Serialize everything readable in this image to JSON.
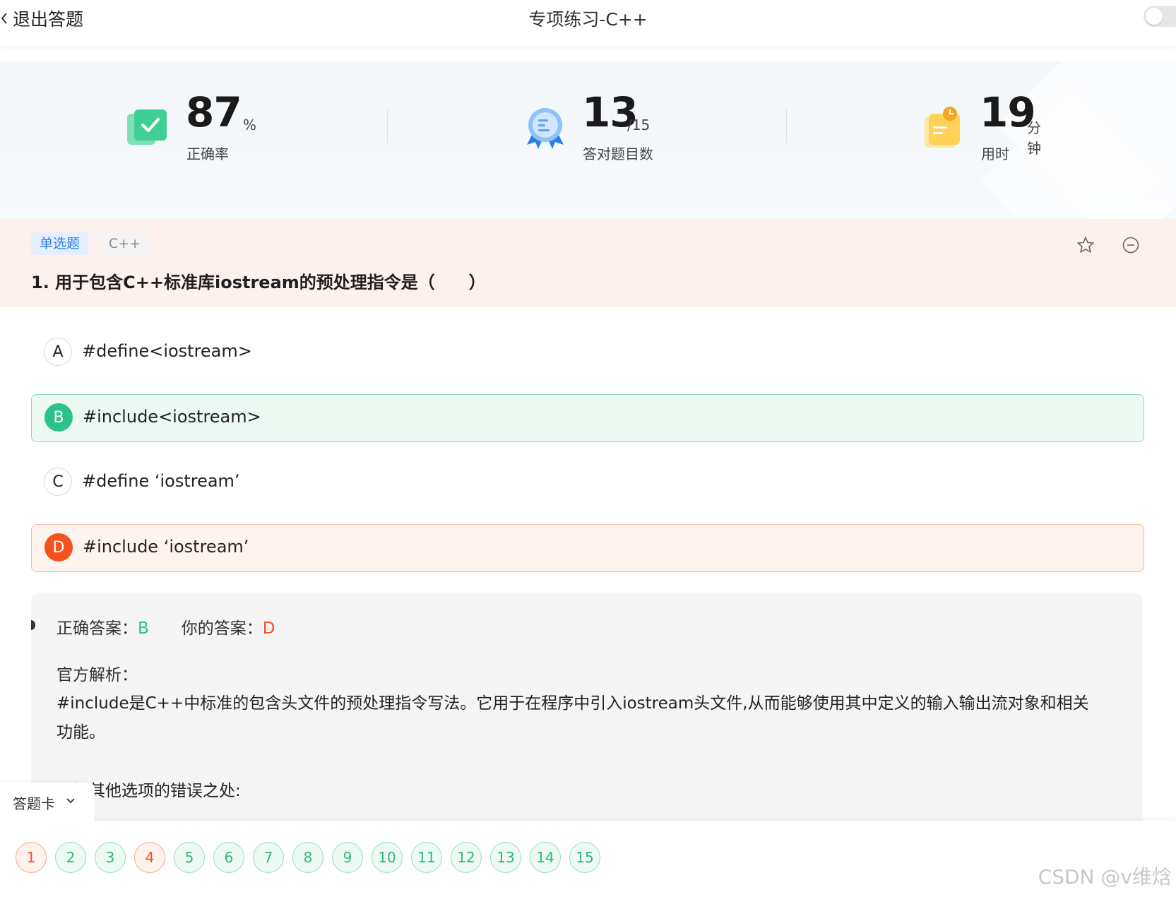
{
  "header": {
    "back_label": "退出答题",
    "title": "专项练习-C++"
  },
  "stats": {
    "accuracy": {
      "value": "87",
      "unit": "%",
      "label": "正确率"
    },
    "correct_count": {
      "value": "13",
      "unit": "/15",
      "label": "答对题目数"
    },
    "time": {
      "value": "19",
      "unit": "分钟",
      "label": "用时"
    }
  },
  "question": {
    "type_tag": "单选题",
    "lang_tag": "C++",
    "text": "1. 用于包含C++标准库iostream的预处理指令是（　　）",
    "options": [
      {
        "letter": "A",
        "text": "#define<iostream>",
        "state": "normal"
      },
      {
        "letter": "B",
        "text": "#include<iostream>",
        "state": "correct"
      },
      {
        "letter": "C",
        "text": "#define ‘iostream’",
        "state": "normal"
      },
      {
        "letter": "D",
        "text": "#include ‘iostream’",
        "state": "wrong"
      }
    ]
  },
  "analysis": {
    "correct_label": "正确答案：",
    "correct_value": "B",
    "mine_label": "你的答案：",
    "mine_value": "D",
    "title": "官方解析：",
    "body": "#include是C++中标准的包含头文件的预处理指令写法。它用于在程序中引入iostream头文件,从而能够使用其中定义的输入输出流对象和相关功能。",
    "more": "分析其他选项的错误之处:"
  },
  "answer_card": {
    "label": "答题卡",
    "items": [
      {
        "n": "1",
        "state": "wrong"
      },
      {
        "n": "2",
        "state": "correct"
      },
      {
        "n": "3",
        "state": "correct"
      },
      {
        "n": "4",
        "state": "wrong"
      },
      {
        "n": "5",
        "state": "correct"
      },
      {
        "n": "6",
        "state": "correct"
      },
      {
        "n": "7",
        "state": "correct"
      },
      {
        "n": "8",
        "state": "correct"
      },
      {
        "n": "9",
        "state": "correct"
      },
      {
        "n": "10",
        "state": "correct"
      },
      {
        "n": "11",
        "state": "correct"
      },
      {
        "n": "12",
        "state": "correct"
      },
      {
        "n": "13",
        "state": "correct"
      },
      {
        "n": "14",
        "state": "correct"
      },
      {
        "n": "15",
        "state": "correct"
      }
    ]
  },
  "watermark": "CSDN @v维焓",
  "colors": {
    "correct": "#2cc28a",
    "wrong": "#f4511e",
    "accent_blue": "#2f7be8"
  },
  "icons": [
    "chevron-left-icon",
    "check-doc-icon",
    "medal-icon",
    "clock-note-icon",
    "star-icon",
    "minus-circle-icon",
    "chevron-down-icon"
  ]
}
